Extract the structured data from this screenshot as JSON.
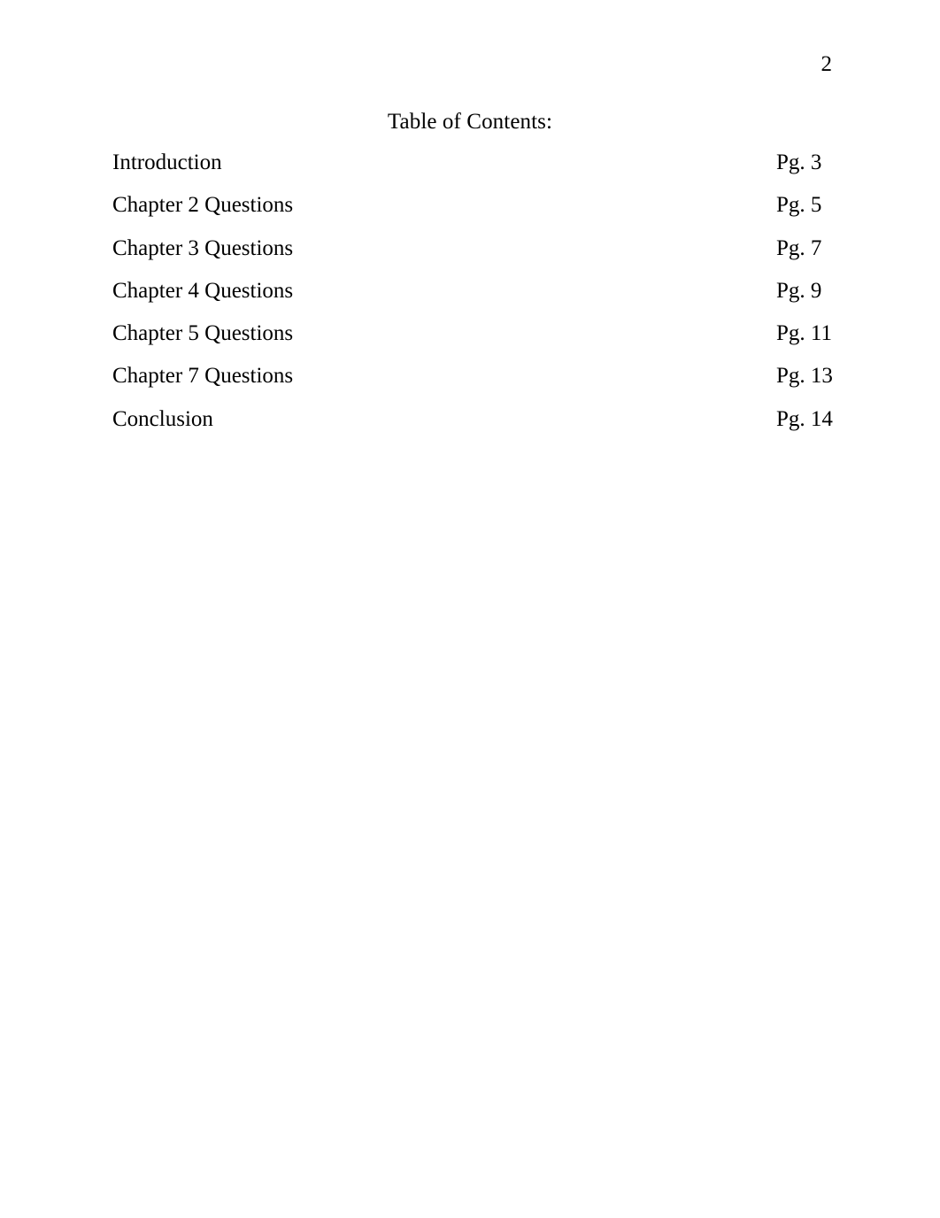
{
  "document": {
    "page_number": "2",
    "title": "Table of Contents:"
  },
  "toc": {
    "entries": [
      {
        "label": "Introduction",
        "page": "Pg. 3"
      },
      {
        "label": "Chapter 2 Questions",
        "page": "Pg. 5"
      },
      {
        "label": "Chapter 3 Questions",
        "page": "Pg. 7"
      },
      {
        "label": "Chapter 4 Questions",
        "page": "Pg. 9"
      },
      {
        "label": "Chapter 5 Questions",
        "page": "Pg. 11"
      },
      {
        "label": "Chapter 7 Questions",
        "page": "Pg. 13"
      },
      {
        "label": "Conclusion",
        "page": "Pg. 14"
      }
    ]
  },
  "colors": {
    "text": "#000000",
    "background": "#ffffff"
  }
}
